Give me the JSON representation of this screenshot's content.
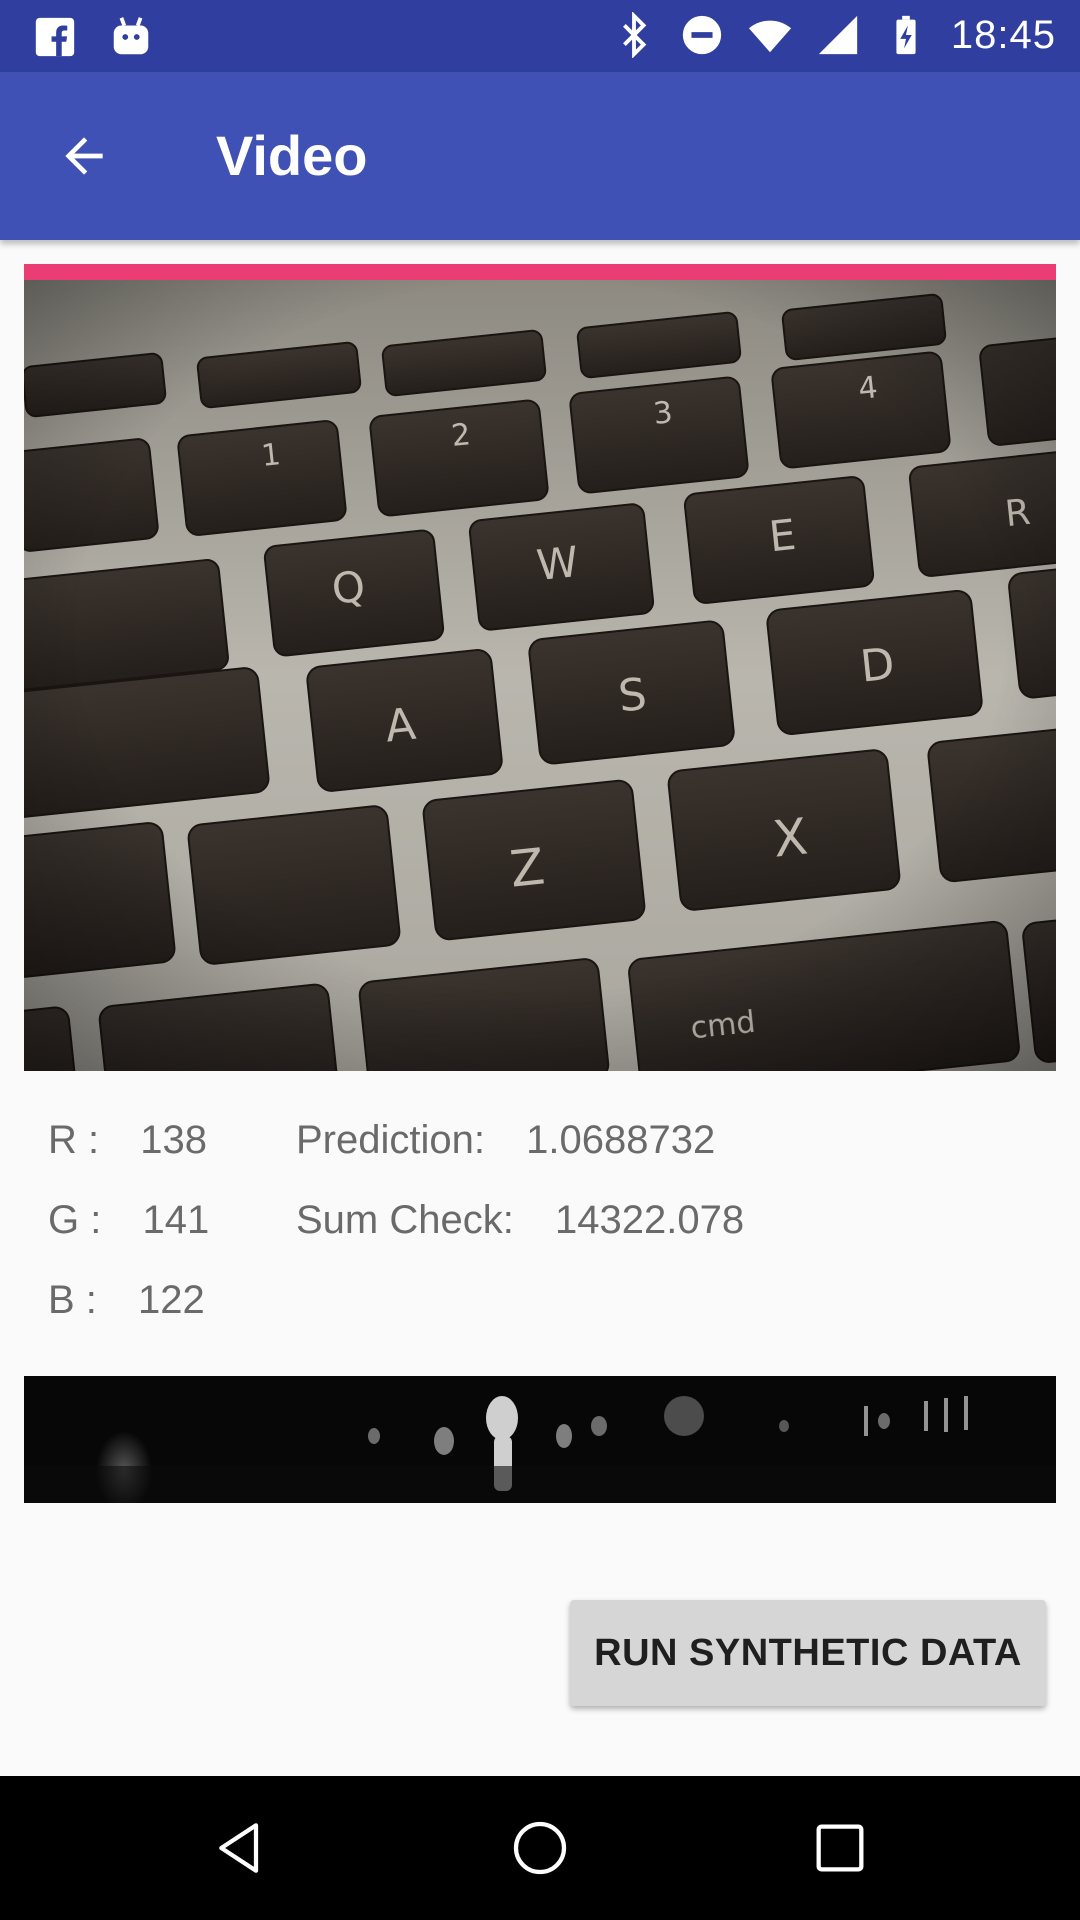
{
  "status_bar": {
    "time": "18:45",
    "left_icons": [
      "facebook-icon",
      "android-debug-icon"
    ],
    "right_icons": [
      "bluetooth-icon",
      "do-not-disturb-icon",
      "wifi-icon",
      "cell-signal-icon",
      "battery-charging-icon"
    ]
  },
  "app_bar": {
    "title": "Video",
    "back_icon": "arrow-left-icon"
  },
  "camera": {
    "accent_color": "#e93d74"
  },
  "readout": {
    "r_label": "R :",
    "r_value": "138",
    "g_label": "G :",
    "g_value": "141",
    "b_label": "B :",
    "b_value": "122",
    "prediction_label": "Prediction:",
    "prediction_value": "1.0688732",
    "sum_check_label": "Sum Check:",
    "sum_check_value": "14322.078"
  },
  "actions": {
    "run_label": "RUN SYNTHETIC DATA"
  },
  "nav_bar": {
    "icons": [
      "nav-back-icon",
      "nav-home-icon",
      "nav-recents-icon"
    ]
  },
  "colors": {
    "status_bar": "#303f9f",
    "app_bar": "#3f51b5",
    "accent": "#e93d74",
    "background": "#fafafa"
  }
}
